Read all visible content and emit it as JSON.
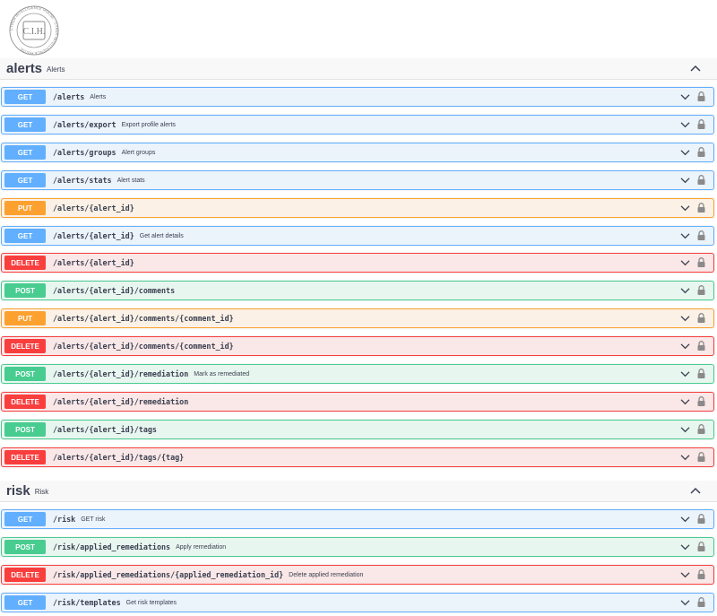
{
  "logo": {
    "ring_text": "CYBER INTELLIGENCE HOUSE · CYBER INTELLIGENCE HOUSE ·",
    "monogram": "C.I.H."
  },
  "sections": [
    {
      "title": "alerts",
      "description": "Alerts",
      "operations": [
        {
          "method": "GET",
          "path": "/alerts",
          "summary": "Alerts"
        },
        {
          "method": "GET",
          "path": "/alerts/export",
          "summary": "Export profile alerts"
        },
        {
          "method": "GET",
          "path": "/alerts/groups",
          "summary": "Alert groups"
        },
        {
          "method": "GET",
          "path": "/alerts/stats",
          "summary": "Alert stats"
        },
        {
          "method": "PUT",
          "path": "/alerts/{alert_id}",
          "summary": ""
        },
        {
          "method": "GET",
          "path": "/alerts/{alert_id}",
          "summary": "Get alert details"
        },
        {
          "method": "DELETE",
          "path": "/alerts/{alert_id}",
          "summary": ""
        },
        {
          "method": "POST",
          "path": "/alerts/{alert_id}/comments",
          "summary": ""
        },
        {
          "method": "PUT",
          "path": "/alerts/{alert_id}/comments/{comment_id}",
          "summary": ""
        },
        {
          "method": "DELETE",
          "path": "/alerts/{alert_id}/comments/{comment_id}",
          "summary": ""
        },
        {
          "method": "POST",
          "path": "/alerts/{alert_id}/remediation",
          "summary": "Mark as remediated"
        },
        {
          "method": "DELETE",
          "path": "/alerts/{alert_id}/remediation",
          "summary": ""
        },
        {
          "method": "POST",
          "path": "/alerts/{alert_id}/tags",
          "summary": ""
        },
        {
          "method": "DELETE",
          "path": "/alerts/{alert_id}/tags/{tag}",
          "summary": ""
        }
      ]
    },
    {
      "title": "risk",
      "description": "Risk",
      "operations": [
        {
          "method": "GET",
          "path": "/risk",
          "summary": "GET risk"
        },
        {
          "method": "POST",
          "path": "/risk/applied_remediations",
          "summary": "Apply remediation"
        },
        {
          "method": "DELETE",
          "path": "/risk/applied_remediations/{applied_remediation_id}",
          "summary": "Delete applied remediation"
        },
        {
          "method": "GET",
          "path": "/risk/templates",
          "summary": "Get risk templates"
        }
      ]
    }
  ],
  "colors": {
    "get": "#61affe",
    "put": "#fca130",
    "post": "#49cc90",
    "delete": "#f93e3e"
  }
}
